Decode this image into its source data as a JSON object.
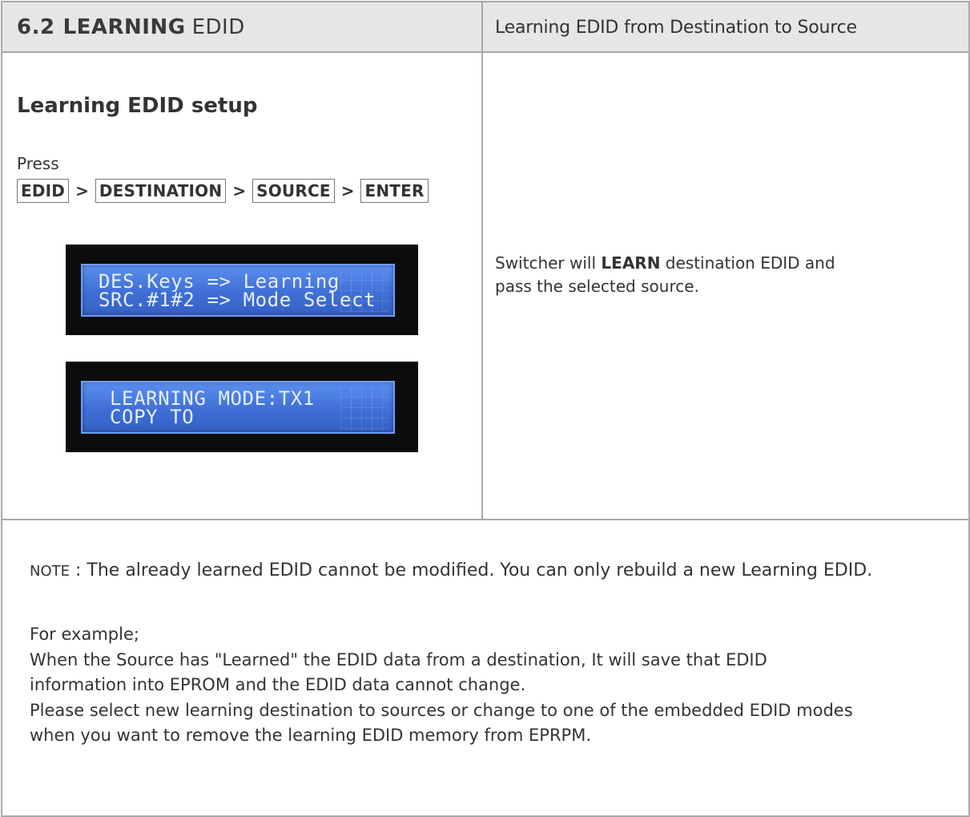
{
  "header": {
    "section_number": "6.2",
    "section_title_bold": "LEARNING",
    "section_title_light": "EDID",
    "right_title": "Learning EDID from Destination to Source"
  },
  "left": {
    "setup_title": "Learning EDID setup",
    "press_label": "Press",
    "keys": [
      "EDID",
      "DESTINATION",
      "SOURCE",
      "ENTER"
    ],
    "separator": ">",
    "lcd1": {
      "line1": "DES.Keys => Learning",
      "line2": "SRC.#1#2 => Mode Select"
    },
    "lcd2": {
      "line1": "LEARNING MODE:TX1",
      "line2": "COPY TO"
    }
  },
  "right": {
    "text_before": "Switcher will ",
    "text_bold": "LEARN",
    "text_after": " destination EDID and",
    "text_line2": "pass the selected source."
  },
  "note": {
    "tag": "NOTE",
    "text": " : The already learned EDID cannot be modified.  You can only rebuild a new Learning EDID."
  },
  "example": {
    "lines": [
      "For example;",
      "When the Source has \"Learned\" the EDID data from a destination, It will save that EDID",
      "information into EPROM and the EDID data cannot change.",
      "Please select new learning destination to sources or change to one of the embedded EDID modes",
      "when you want to remove the learning EDID memory from EPRPM."
    ]
  }
}
